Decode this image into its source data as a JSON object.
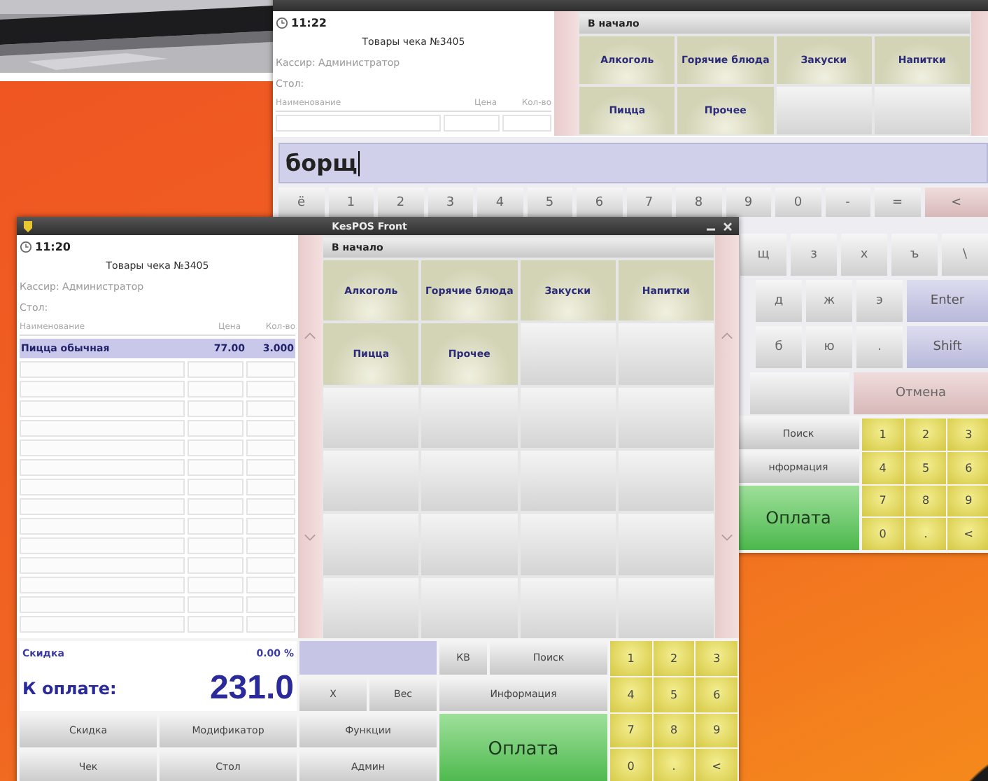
{
  "back_window": {
    "receipt": {
      "time": "11:22",
      "title": "Товары чека №3405",
      "cashier": "Кассир: Администратор",
      "table_label": "Стол:",
      "columns": [
        "Наименование",
        "Цена",
        "Кол-во"
      ]
    },
    "categories": {
      "home": "В начало",
      "items": [
        {
          "label": "Алкоголь"
        },
        {
          "label": "Горячие блюда"
        },
        {
          "label": "Закуски"
        },
        {
          "label": "Напитки"
        },
        {
          "label": "Пицца"
        },
        {
          "label": "Прочее"
        }
      ]
    },
    "search": {
      "value": "борщ"
    },
    "keyboard_rows": [
      [
        {
          "label": "ё",
          "kind": "char"
        },
        {
          "label": "1",
          "kind": "char"
        },
        {
          "label": "2",
          "kind": "char"
        },
        {
          "label": "3",
          "kind": "char"
        },
        {
          "label": "4",
          "kind": "char"
        },
        {
          "label": "5",
          "kind": "char"
        },
        {
          "label": "6",
          "kind": "char"
        },
        {
          "label": "7",
          "kind": "char"
        },
        {
          "label": "8",
          "kind": "char"
        },
        {
          "label": "9",
          "kind": "char"
        },
        {
          "label": "0",
          "kind": "char"
        },
        {
          "label": "-",
          "kind": "char"
        },
        {
          "label": "=",
          "kind": "char"
        },
        {
          "label": "<",
          "kind": "warn"
        }
      ],
      [
        {
          "label": "щ",
          "kind": "char"
        },
        {
          "label": "з",
          "kind": "char"
        },
        {
          "label": "х",
          "kind": "char"
        },
        {
          "label": "ъ",
          "kind": "char"
        },
        {
          "label": "\\",
          "kind": "char"
        }
      ],
      [
        {
          "label": "д",
          "kind": "char"
        },
        {
          "label": "ж",
          "kind": "char"
        },
        {
          "label": "э",
          "kind": "char"
        },
        {
          "label": "Enter",
          "kind": "accent"
        }
      ],
      [
        {
          "label": "б",
          "kind": "char"
        },
        {
          "label": "ю",
          "kind": "char"
        },
        {
          "label": ".",
          "kind": "char"
        },
        {
          "label": "Shift",
          "kind": "accent"
        }
      ],
      [
        {
          "kind": "blank"
        },
        {
          "label": "Отмена",
          "kind": "warn"
        }
      ]
    ],
    "actions": [
      "Поиск",
      "нформация"
    ],
    "pay": "Оплата",
    "numpad": [
      "1",
      "2",
      "3",
      "4",
      "5",
      "6",
      "7",
      "8",
      "9",
      "0",
      ".",
      "<"
    ]
  },
  "front_window": {
    "title": "KesPOS Front",
    "receipt": {
      "time": "11:20",
      "title": "Товары чека №3405",
      "cashier": "Кассир: Администратор",
      "table_label": "Стол:",
      "columns": [
        "Наименование",
        "Цена",
        "Кол-во"
      ],
      "rows": [
        {
          "name": "Пицца обычная",
          "price": "77.00",
          "qty": "3.000",
          "selected": true
        }
      ]
    },
    "categories": {
      "home": "В начало",
      "items": [
        {
          "label": "Алкоголь"
        },
        {
          "label": "Горячие блюда"
        },
        {
          "label": "Закуски"
        },
        {
          "label": "Напитки"
        },
        {
          "label": "Пицца"
        },
        {
          "label": "Прочее"
        }
      ]
    },
    "discount": {
      "label": "Скидка",
      "value": "0.00 %"
    },
    "total": {
      "label": "К оплате:",
      "value": "231.0"
    },
    "top_keys": [
      "КВ",
      "Поиск"
    ],
    "mid_keys": [
      "Х",
      "Вес"
    ],
    "info_key": "Информация",
    "pay": "Оплата",
    "bottom_buttons": [
      "Скидка",
      "Модификатор",
      "Функции",
      "Чек",
      "Стол",
      "Админ"
    ],
    "numpad": [
      "1",
      "2",
      "3",
      "4",
      "5",
      "6",
      "7",
      "8",
      "9",
      "0",
      ".",
      "<"
    ]
  }
}
